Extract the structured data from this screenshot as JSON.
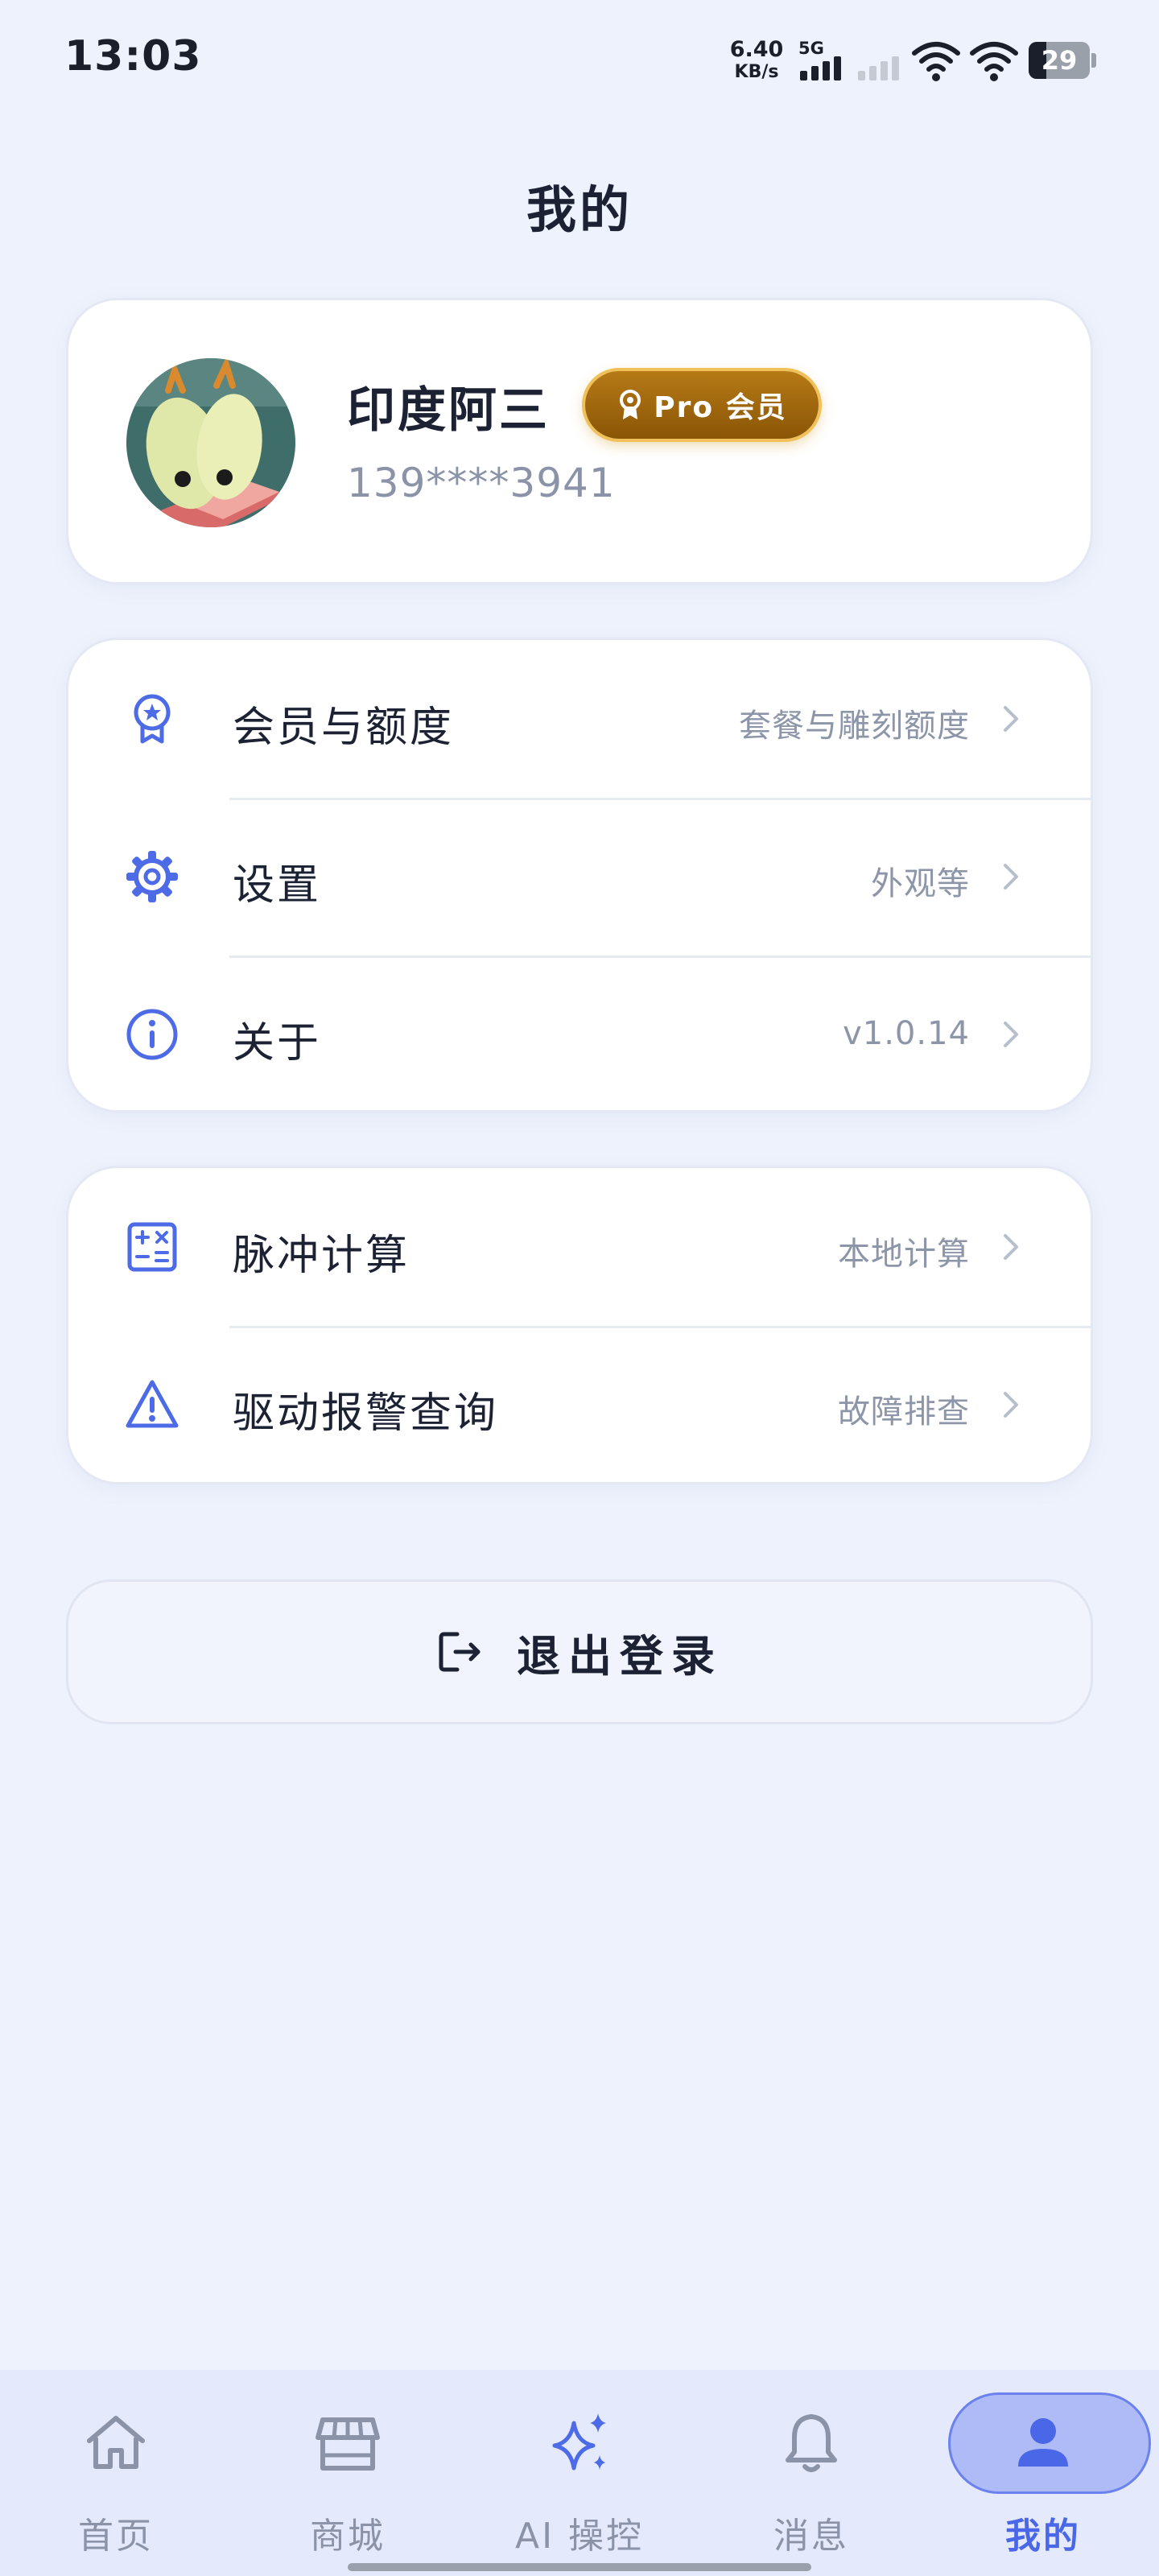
{
  "status_bar": {
    "time": "13:03",
    "net_speed_value": "6.40",
    "net_speed_unit": "KB/s",
    "signal_tag": "5G",
    "battery": "29"
  },
  "page_title": "我的",
  "profile": {
    "username": "印度阿三",
    "badge": "Pro 会员",
    "phone": "139****3941"
  },
  "menu_group_1": [
    {
      "label": "会员与额度",
      "value": "套餐与雕刻额度",
      "icon": "award-icon"
    },
    {
      "label": "设置",
      "value": "外观等",
      "icon": "gear-icon"
    },
    {
      "label": "关于",
      "value": "v1.0.14",
      "icon": "info-icon"
    }
  ],
  "menu_group_2": [
    {
      "label": "脉冲计算",
      "value": "本地计算",
      "icon": "calculator-icon"
    },
    {
      "label": "驱动报警查询",
      "value": "故障排查",
      "icon": "warning-icon"
    }
  ],
  "logout_label": "退出登录",
  "bottom_nav": [
    {
      "label": "首页",
      "icon": "home-icon"
    },
    {
      "label": "商城",
      "icon": "store-icon"
    },
    {
      "label": "AI 操控",
      "icon": "sparkle-icon"
    },
    {
      "label": "消息",
      "icon": "bell-icon"
    },
    {
      "label": "我的",
      "icon": "user-icon",
      "active": true
    }
  ],
  "colors": {
    "accent": "#4a67e8",
    "icon_blue": "#4d6be6",
    "background": "#eef2fc",
    "badge_gold": "#a06a10"
  }
}
